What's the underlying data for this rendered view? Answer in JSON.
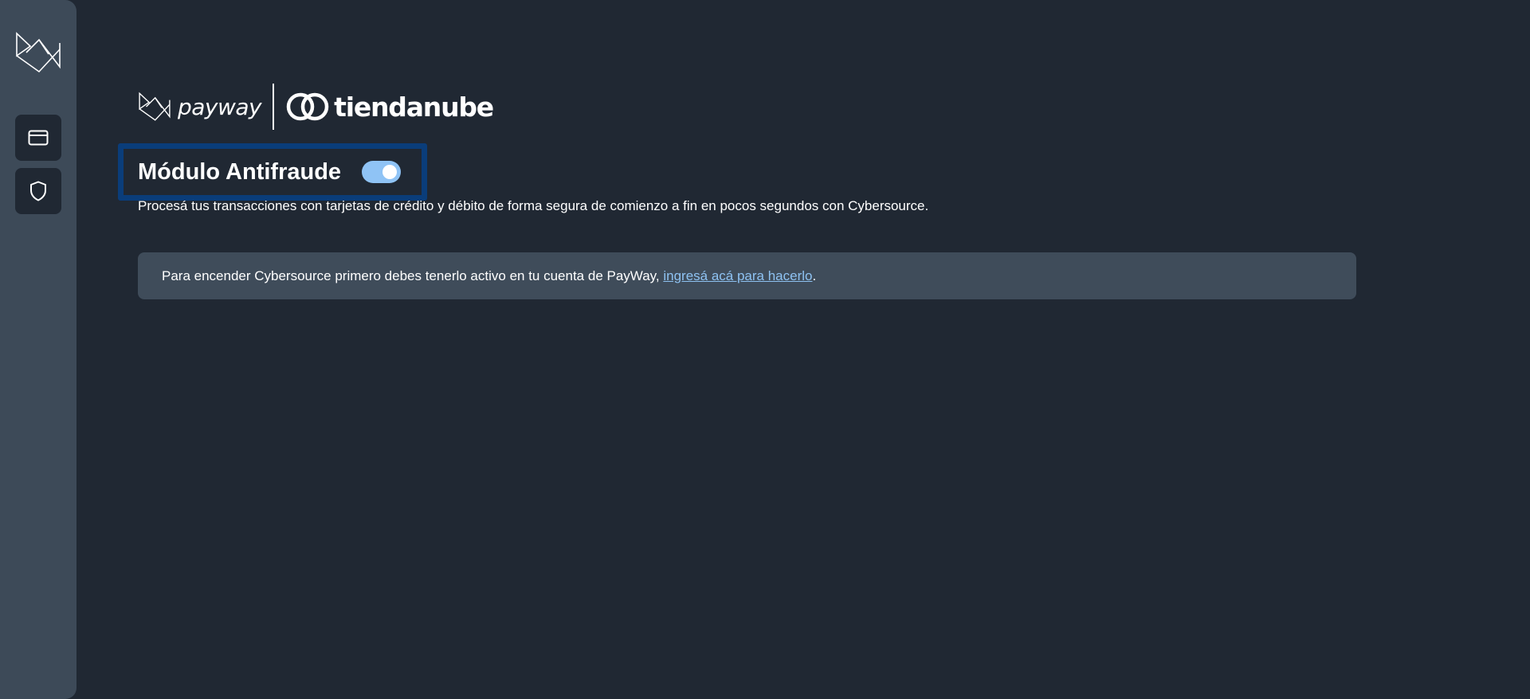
{
  "sidebar": {
    "logo_icon": "payway-logo-icon",
    "items": [
      {
        "icon": "credit-card-icon"
      },
      {
        "icon": "shield-icon"
      }
    ]
  },
  "brand": {
    "payway_label": "payway",
    "tiendanube_label": "tiendanube"
  },
  "module": {
    "title": "Módulo Antifraude",
    "toggle_state": "on",
    "description": "Procesá tus transacciones con tarjetas de crédito y débito de forma segura de comienzo a fin en pocos segundos con Cybersource."
  },
  "notice": {
    "text_before": "Para encender Cybersource primero debes tenerlo activo en tu cuenta de PayWay, ",
    "link_label": "ingresá acá para hacerlo",
    "text_after": "."
  },
  "colors": {
    "background": "#202833",
    "sidebar": "#3d4a58",
    "accent": "#8fc3f5",
    "highlight_border": "#0a3d7a"
  }
}
